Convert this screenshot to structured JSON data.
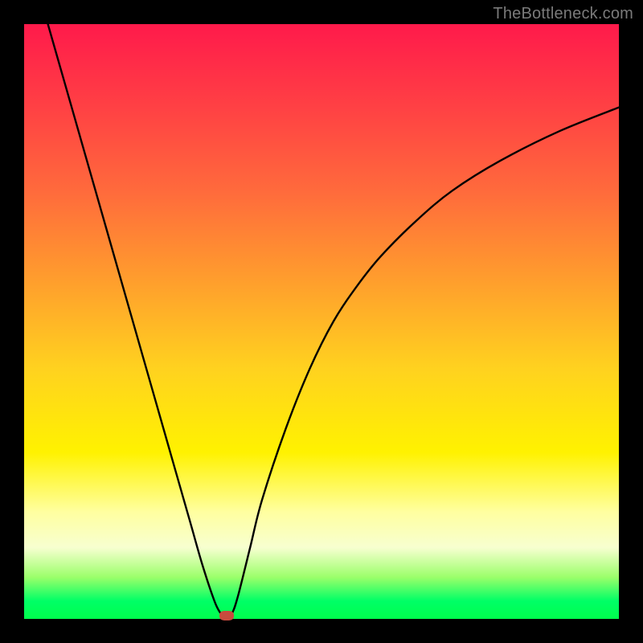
{
  "watermark": "TheBottleneck.com",
  "chart_data": {
    "type": "line",
    "title": "",
    "xlabel": "",
    "ylabel": "",
    "xlim": [
      0,
      100
    ],
    "ylim": [
      0,
      100
    ],
    "grid": false,
    "legend": false,
    "background": {
      "type": "vertical-gradient",
      "stops": [
        {
          "pos": 0,
          "color": "#ff1a4b"
        },
        {
          "pos": 0.5,
          "color": "#ffd21f"
        },
        {
          "pos": 0.82,
          "color": "#ffffa0"
        },
        {
          "pos": 1.0,
          "color": "#00ff4d"
        }
      ]
    },
    "series": [
      {
        "name": "curve",
        "color": "#000000",
        "x": [
          4,
          6,
          8,
          10,
          12,
          14,
          16,
          18,
          20,
          22,
          24,
          26,
          28,
          30,
          32,
          33,
          34,
          35,
          36,
          38,
          40,
          44,
          48,
          52,
          56,
          60,
          66,
          72,
          80,
          90,
          100
        ],
        "y": [
          100,
          93,
          86,
          79,
          72,
          65,
          58,
          51,
          44,
          37,
          30,
          23,
          16,
          9,
          3,
          1,
          0,
          1,
          4,
          12,
          20,
          32,
          42,
          50,
          56,
          61,
          67,
          72,
          77,
          82,
          86
        ]
      }
    ],
    "marker": {
      "x": 34,
      "y": 0,
      "color": "#c84b3e"
    }
  }
}
